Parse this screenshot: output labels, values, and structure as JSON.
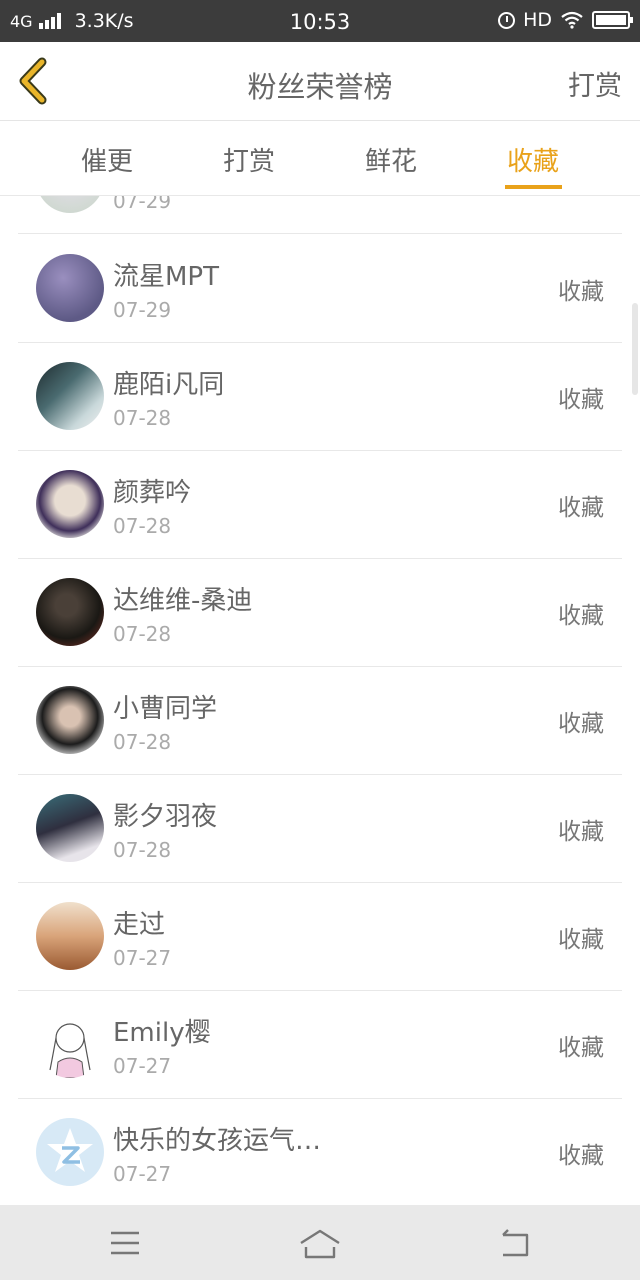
{
  "status_bar": {
    "network": "4G",
    "speed": "3.3K/s",
    "time": "10:53",
    "hd": "HD"
  },
  "header": {
    "title": "粉丝荣誉榜",
    "right_action": "打赏"
  },
  "tabs": [
    {
      "label": "催更",
      "active": false
    },
    {
      "label": "打赏",
      "active": false
    },
    {
      "label": "鲜花",
      "active": false
    },
    {
      "label": "收藏",
      "active": true
    }
  ],
  "accent_color": "#e9a21a",
  "partial_row": {
    "date": "07-29"
  },
  "rows": [
    {
      "name": "流星MPT",
      "date": "07-29",
      "action": "收藏"
    },
    {
      "name": "鹿陌i凡同",
      "date": "07-28",
      "action": "收藏"
    },
    {
      "name": "颜葬吟",
      "date": "07-28",
      "action": "收藏"
    },
    {
      "name": "达维维-桑迪",
      "date": "07-28",
      "action": "收藏"
    },
    {
      "name": "小曹同学",
      "date": "07-28",
      "action": "收藏"
    },
    {
      "name": "影夕羽夜",
      "date": "07-28",
      "action": "收藏"
    },
    {
      "name": "走过",
      "date": "07-27",
      "action": "收藏"
    },
    {
      "name": "Emily樱",
      "date": "07-27",
      "action": "收藏"
    },
    {
      "name": "快乐的女孩运气…",
      "date": "07-27",
      "action": "收藏"
    }
  ],
  "nav_icons": [
    "menu-icon",
    "home-icon",
    "back-icon"
  ]
}
